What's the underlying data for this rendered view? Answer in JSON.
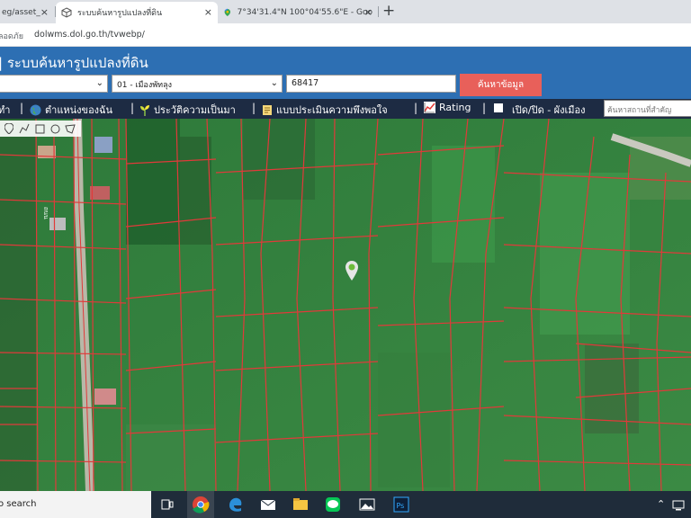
{
  "browser": {
    "tabs": [
      {
        "label": "eg/asset_",
        "active": false
      },
      {
        "label": "ระบบค้นหารูปแปลงที่ดิน",
        "active": true
      },
      {
        "label": "7°34'31.4\"N 100°04'55.6\"E - Goo",
        "active": false
      }
    ],
    "new_tab": "+",
    "close": "×",
    "security_label": "ลอดภัย",
    "url": "dolwms.dol.go.th/tvwebp/"
  },
  "app": {
    "title": "| ระบบค้นหารูปแปลงที่ดิน",
    "district_select": "01 - เมืองพัทลุง",
    "parcel_number": "68417",
    "search_button": "ค้นหาข้อมูล",
    "accent": "#2d6fb3",
    "button_color": "#e8605a"
  },
  "menu": {
    "items": [
      {
        "label": "ทำ",
        "icon": "none"
      },
      {
        "label": "ตำแหน่งของฉัน",
        "icon": "globe-icon"
      },
      {
        "label": "ประวัติความเป็นมา",
        "icon": "plant-icon"
      },
      {
        "label": "แบบประเมินความพึงพอใจ",
        "icon": "note-icon"
      },
      {
        "label": "Rating",
        "icon": "chart-icon"
      },
      {
        "label": "เปิด/ปิด - ผังเมือง",
        "icon": "checkbox-icon"
      }
    ],
    "separator": "|",
    "search_placeholder": "ค้นหาสถานที่สำคัญ",
    "bar_color": "#1d2b43"
  },
  "map": {
    "tools": [
      "pin-tool-icon",
      "line-tool-icon",
      "square-tool-icon",
      "circle-tool-icon",
      "polygon-tool-icon"
    ],
    "road_label": "ถนน",
    "parcel_line_color": "#e03a3a",
    "marker": "map-pin-icon"
  },
  "taskbar": {
    "search_text": "o search",
    "apps": [
      "task-view-icon",
      "chrome-icon",
      "edge-icon",
      "mail-icon",
      "file-explorer-icon",
      "line-icon",
      "photos-icon",
      "photoshop-icon"
    ],
    "tray": [
      "chevron-up-icon",
      "network-icon"
    ]
  }
}
